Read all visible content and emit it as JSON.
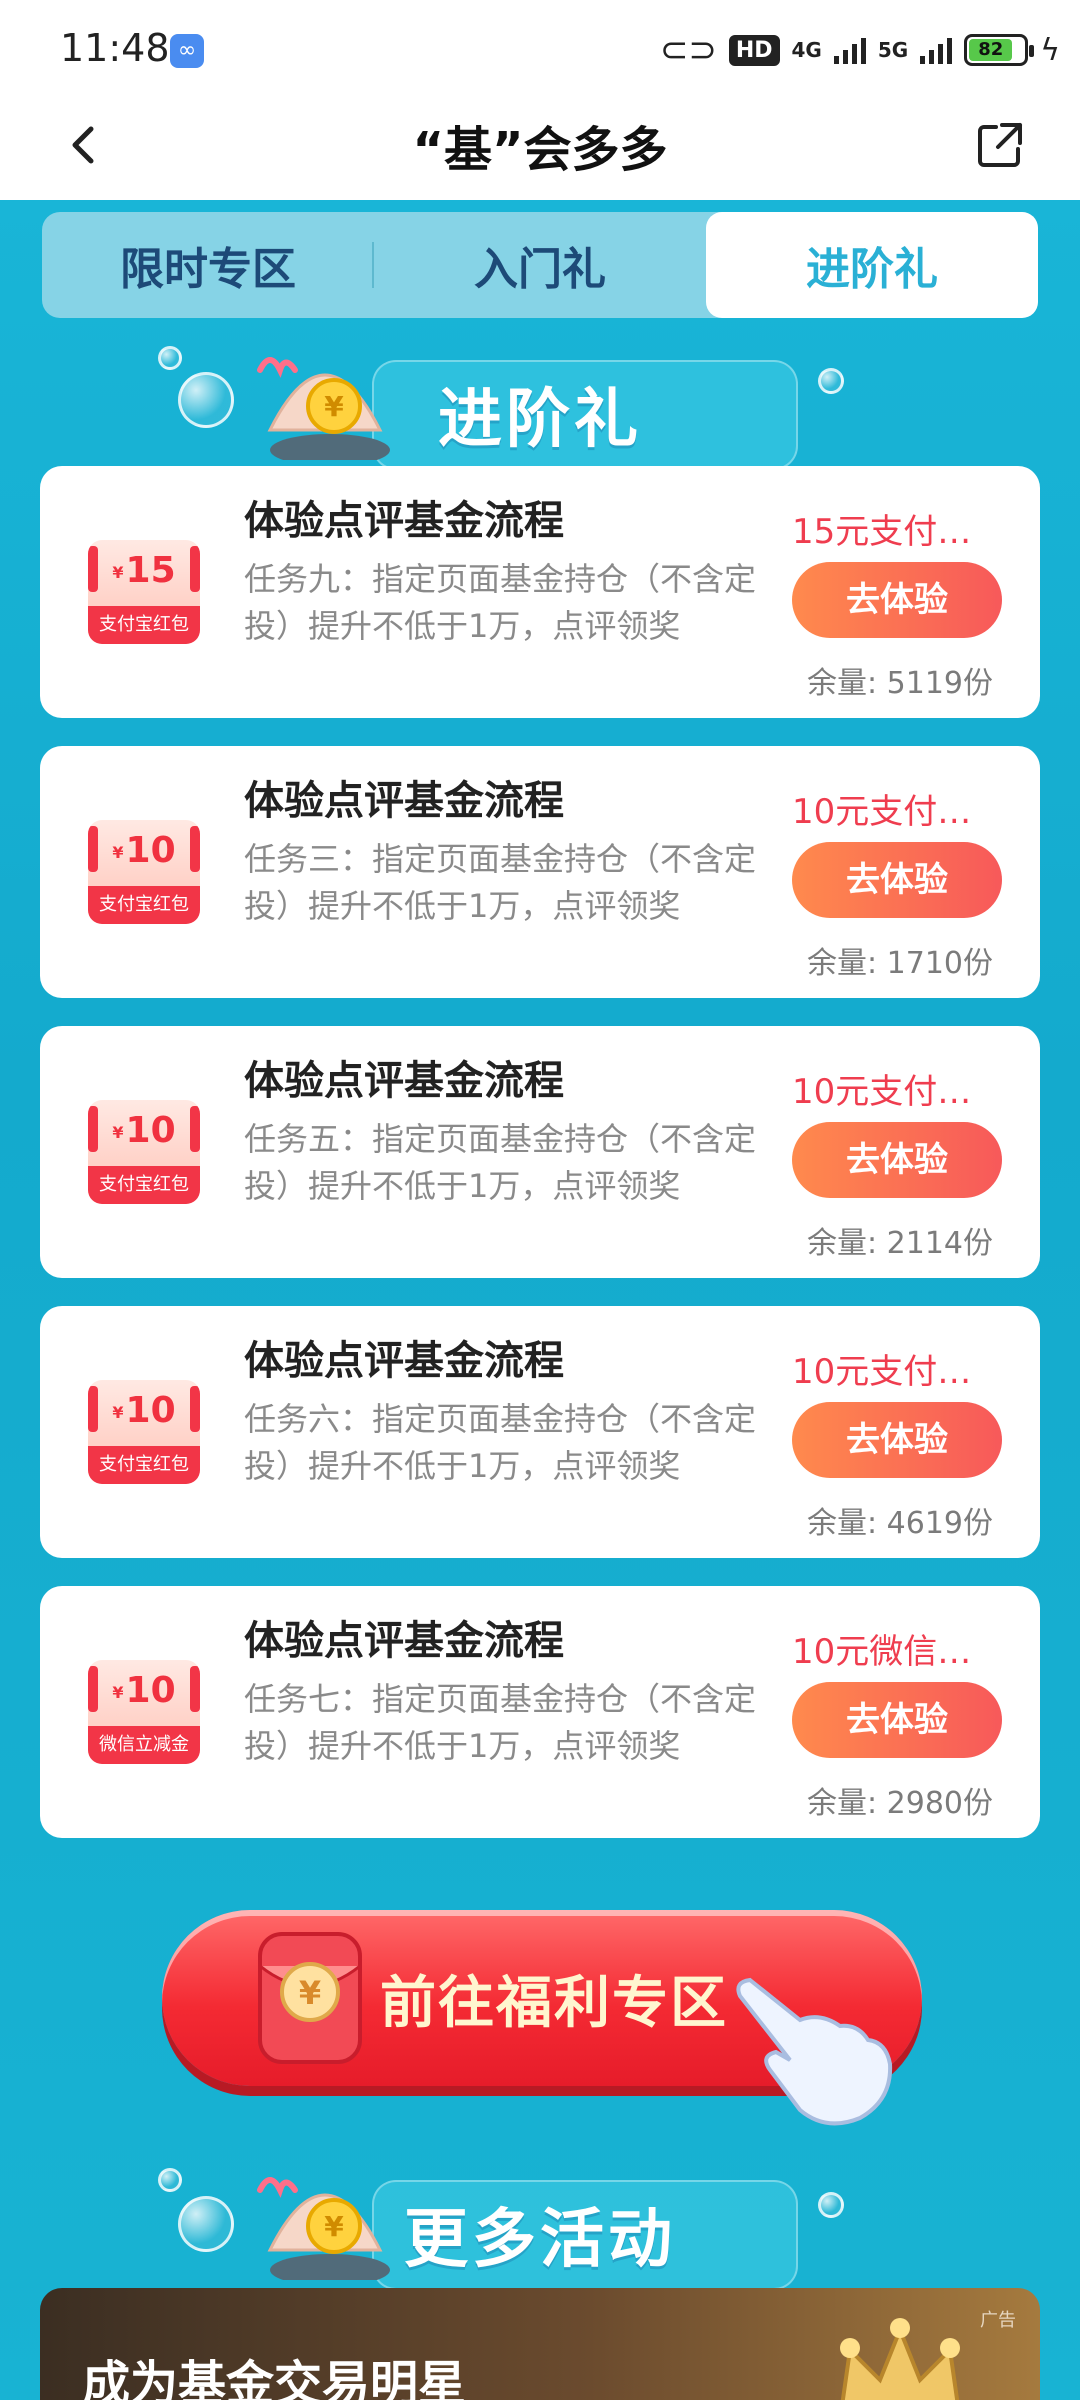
{
  "status_bar": {
    "time": "11:48",
    "hd": "HD",
    "net1": "4G",
    "net2": "5G",
    "battery": "82"
  },
  "header": {
    "title": "“基”会多多"
  },
  "tabs": [
    {
      "label": "限时专区",
      "active": false
    },
    {
      "label": "入门礼",
      "active": false
    },
    {
      "label": "进阶礼",
      "active": true
    }
  ],
  "section1": {
    "title": "进阶礼"
  },
  "tasks": [
    {
      "title": "体验点评基金流程",
      "desc": "任务九：指定页面基金持仓（不含定投）提升不低于1万，点评领奖",
      "coupon_amount": "15",
      "coupon_label": "支付宝红包",
      "reward": "15元支付…",
      "button": "去体验",
      "remaining": "余量: 5119份"
    },
    {
      "title": "体验点评基金流程",
      "desc": "任务三：指定页面基金持仓（不含定投）提升不低于1万，点评领奖",
      "coupon_amount": "10",
      "coupon_label": "支付宝红包",
      "reward": "10元支付…",
      "button": "去体验",
      "remaining": "余量: 1710份"
    },
    {
      "title": "体验点评基金流程",
      "desc": "任务五：指定页面基金持仓（不含定投）提升不低于1万，点评领奖",
      "coupon_amount": "10",
      "coupon_label": "支付宝红包",
      "reward": "10元支付…",
      "button": "去体验",
      "remaining": "余量: 2114份"
    },
    {
      "title": "体验点评基金流程",
      "desc": "任务六：指定页面基金持仓（不含定投）提升不低于1万，点评领奖",
      "coupon_amount": "10",
      "coupon_label": "支付宝红包",
      "reward": "10元支付…",
      "button": "去体验",
      "remaining": "余量: 4619份"
    },
    {
      "title": "体验点评基金流程",
      "desc": "任务七：指定页面基金持仓（不含定投）提升不低于1万，点评领奖",
      "coupon_amount": "10",
      "coupon_label": "微信立减金",
      "reward": "10元微信…",
      "button": "去体验",
      "remaining": "余量: 2980份"
    }
  ],
  "currency_symbol": "¥",
  "welfare_button": {
    "label": "前往福利专区"
  },
  "section2": {
    "title": "更多活动"
  },
  "promo": {
    "title": "成为基金交易明星",
    "ad_tag": "广告"
  },
  "colors": {
    "background": "#16afd0",
    "accent_red": "#ef3d4f",
    "button_orange": "#ff8a4d",
    "tab_active_text": "#2ab0d5"
  }
}
